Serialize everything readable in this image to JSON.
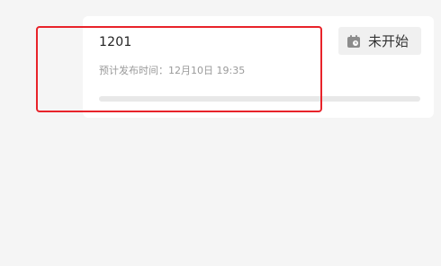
{
  "card": {
    "title": "1201",
    "schedule_label": "预计发布时间：",
    "schedule_value": "12月10日 19:35",
    "progress_fraction": 0
  },
  "status_badge": {
    "label": "未开始",
    "icon": "calendar-clock-icon"
  },
  "colors": {
    "highlight_border": "#e8232a",
    "page_background": "#f5f5f5",
    "card_background": "#ffffff",
    "badge_background": "#f0f0f0"
  }
}
